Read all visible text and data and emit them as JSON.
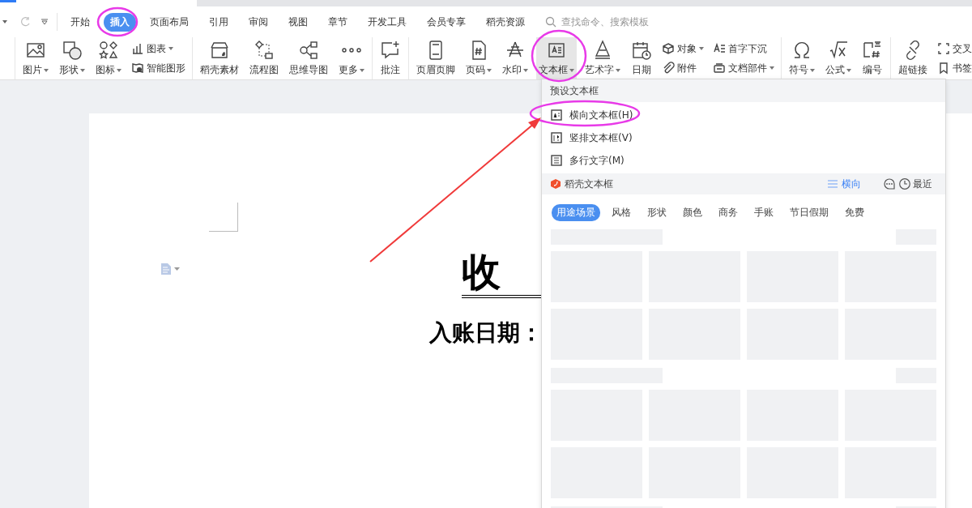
{
  "menu_tabs": [
    {
      "label": "开始",
      "selected": false
    },
    {
      "label": "插入",
      "selected": true
    },
    {
      "label": "页面布局",
      "selected": false
    },
    {
      "label": "引用",
      "selected": false
    },
    {
      "label": "审阅",
      "selected": false
    },
    {
      "label": "视图",
      "selected": false
    },
    {
      "label": "章节",
      "selected": false
    },
    {
      "label": "开发工具",
      "selected": false
    },
    {
      "label": "会员专享",
      "selected": false
    },
    {
      "label": "稻壳资源",
      "selected": false
    }
  ],
  "search": {
    "placeholder": "查找命令、搜索模板"
  },
  "ribbon_groups": [
    {
      "items": [
        {
          "kind": "large",
          "label": "图片",
          "dropdown": true,
          "pressed": false
        },
        {
          "kind": "large",
          "label": "形状",
          "dropdown": true,
          "pressed": false
        },
        {
          "kind": "large",
          "label": "图标",
          "dropdown": true,
          "pressed": false
        },
        {
          "kind": "stack",
          "entries": [
            {
              "label": "图表",
              "dropdown": true
            },
            {
              "label": "智能图形",
              "dropdown": false
            }
          ]
        }
      ]
    },
    {
      "items": [
        {
          "kind": "large",
          "label": "稻壳素材",
          "dropdown": false,
          "pressed": false
        },
        {
          "kind": "large",
          "label": "流程图",
          "dropdown": false,
          "pressed": false
        },
        {
          "kind": "large",
          "label": "思维导图",
          "dropdown": false,
          "pressed": false
        },
        {
          "kind": "large",
          "label": "更多",
          "dropdown": true,
          "pressed": false
        }
      ]
    },
    {
      "items": [
        {
          "kind": "large",
          "label": "批注",
          "dropdown": false,
          "pressed": false
        }
      ]
    },
    {
      "items": [
        {
          "kind": "large",
          "label": "页眉页脚",
          "dropdown": false,
          "pressed": false
        },
        {
          "kind": "large",
          "label": "页码",
          "dropdown": true,
          "pressed": false
        },
        {
          "kind": "large",
          "label": "水印",
          "dropdown": true,
          "pressed": false
        },
        {
          "kind": "large",
          "label": "文本框",
          "dropdown": true,
          "pressed": true
        },
        {
          "kind": "large",
          "label": "艺术字",
          "dropdown": true,
          "pressed": false
        },
        {
          "kind": "large",
          "label": "日期",
          "dropdown": false,
          "pressed": false
        },
        {
          "kind": "stack",
          "entries": [
            {
              "label": "对象",
              "dropdown": true
            },
            {
              "label": "附件",
              "dropdown": false
            }
          ]
        },
        {
          "kind": "stack",
          "entries": [
            {
              "label": "首字下沉",
              "dropdown": false
            },
            {
              "label": "文档部件",
              "dropdown": true
            }
          ]
        }
      ]
    },
    {
      "items": [
        {
          "kind": "large",
          "label": "符号",
          "dropdown": true,
          "pressed": false
        },
        {
          "kind": "large",
          "label": "公式",
          "dropdown": true,
          "pressed": false
        },
        {
          "kind": "large",
          "label": "编号",
          "dropdown": false,
          "pressed": false
        }
      ]
    },
    {
      "items": [
        {
          "kind": "large",
          "label": "超链接",
          "dropdown": false,
          "pressed": false
        },
        {
          "kind": "stack",
          "entries": [
            {
              "label": "交叉",
              "dropdown": false
            },
            {
              "label": "书签",
              "dropdown": false
            }
          ]
        }
      ]
    }
  ],
  "document": {
    "title": "收",
    "subtitle": "入账日期："
  },
  "textbox_menu": {
    "header": "预设文本框",
    "presets": [
      {
        "label": "横向文本框(H)"
      },
      {
        "label": "竖排文本框(V)"
      },
      {
        "label": "多行文字(M)"
      }
    ],
    "section": {
      "title": "稻壳文本框",
      "orientation": "横向",
      "recent": "最近"
    },
    "filters": [
      {
        "label": "用途场景",
        "selected": true
      },
      {
        "label": "风格",
        "selected": false
      },
      {
        "label": "形状",
        "selected": false
      },
      {
        "label": "颜色",
        "selected": false
      },
      {
        "label": "商务",
        "selected": false
      },
      {
        "label": "手账",
        "selected": false
      },
      {
        "label": "节日假期",
        "selected": false
      },
      {
        "label": "免费",
        "selected": false
      }
    ]
  }
}
